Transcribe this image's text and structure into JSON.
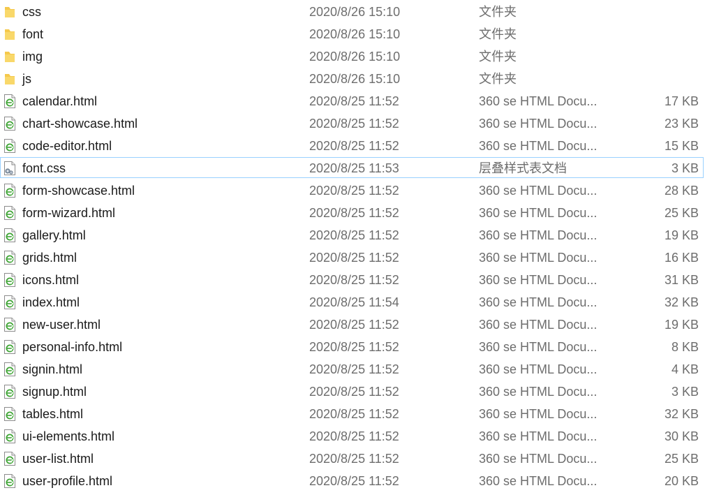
{
  "files": [
    {
      "name": "css",
      "date": "2020/8/26 15:10",
      "type": "文件夹",
      "size": "",
      "icon": "folder-icon"
    },
    {
      "name": "font",
      "date": "2020/8/26 15:10",
      "type": "文件夹",
      "size": "",
      "icon": "folder-icon"
    },
    {
      "name": "img",
      "date": "2020/8/26 15:10",
      "type": "文件夹",
      "size": "",
      "icon": "folder-icon"
    },
    {
      "name": "js",
      "date": "2020/8/26 15:10",
      "type": "文件夹",
      "size": "",
      "icon": "folder-icon"
    },
    {
      "name": "calendar.html",
      "date": "2020/8/25 11:52",
      "type": "360 se HTML Docu...",
      "size": "17 KB",
      "icon": "html-file-icon"
    },
    {
      "name": "chart-showcase.html",
      "date": "2020/8/25 11:52",
      "type": "360 se HTML Docu...",
      "size": "23 KB",
      "icon": "html-file-icon"
    },
    {
      "name": "code-editor.html",
      "date": "2020/8/25 11:52",
      "type": "360 se HTML Docu...",
      "size": "15 KB",
      "icon": "html-file-icon"
    },
    {
      "name": "font.css",
      "date": "2020/8/25 11:53",
      "type": "层叠样式表文档",
      "size": "3 KB",
      "icon": "css-file-icon",
      "focused": true
    },
    {
      "name": "form-showcase.html",
      "date": "2020/8/25 11:52",
      "type": "360 se HTML Docu...",
      "size": "28 KB",
      "icon": "html-file-icon"
    },
    {
      "name": "form-wizard.html",
      "date": "2020/8/25 11:52",
      "type": "360 se HTML Docu...",
      "size": "25 KB",
      "icon": "html-file-icon"
    },
    {
      "name": "gallery.html",
      "date": "2020/8/25 11:52",
      "type": "360 se HTML Docu...",
      "size": "19 KB",
      "icon": "html-file-icon"
    },
    {
      "name": "grids.html",
      "date": "2020/8/25 11:52",
      "type": "360 se HTML Docu...",
      "size": "16 KB",
      "icon": "html-file-icon"
    },
    {
      "name": "icons.html",
      "date": "2020/8/25 11:52",
      "type": "360 se HTML Docu...",
      "size": "31 KB",
      "icon": "html-file-icon"
    },
    {
      "name": "index.html",
      "date": "2020/8/25 11:54",
      "type": "360 se HTML Docu...",
      "size": "32 KB",
      "icon": "html-file-icon"
    },
    {
      "name": "new-user.html",
      "date": "2020/8/25 11:52",
      "type": "360 se HTML Docu...",
      "size": "19 KB",
      "icon": "html-file-icon"
    },
    {
      "name": "personal-info.html",
      "date": "2020/8/25 11:52",
      "type": "360 se HTML Docu...",
      "size": "8 KB",
      "icon": "html-file-icon"
    },
    {
      "name": "signin.html",
      "date": "2020/8/25 11:52",
      "type": "360 se HTML Docu...",
      "size": "4 KB",
      "icon": "html-file-icon"
    },
    {
      "name": "signup.html",
      "date": "2020/8/25 11:52",
      "type": "360 se HTML Docu...",
      "size": "3 KB",
      "icon": "html-file-icon"
    },
    {
      "name": "tables.html",
      "date": "2020/8/25 11:52",
      "type": "360 se HTML Docu...",
      "size": "32 KB",
      "icon": "html-file-icon"
    },
    {
      "name": "ui-elements.html",
      "date": "2020/8/25 11:52",
      "type": "360 se HTML Docu...",
      "size": "30 KB",
      "icon": "html-file-icon"
    },
    {
      "name": "user-list.html",
      "date": "2020/8/25 11:52",
      "type": "360 se HTML Docu...",
      "size": "25 KB",
      "icon": "html-file-icon"
    },
    {
      "name": "user-profile.html",
      "date": "2020/8/25 11:52",
      "type": "360 se HTML Docu...",
      "size": "20 KB",
      "icon": "html-file-icon"
    }
  ],
  "colors": {
    "folder": "#f5c94c",
    "focus_border": "#99d1ff",
    "html_icon_green": "#3fa535"
  }
}
